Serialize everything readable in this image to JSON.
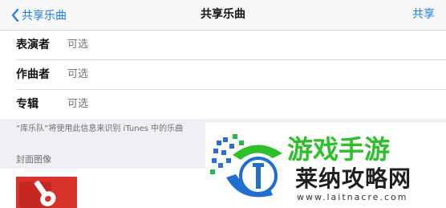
{
  "nav": {
    "back_label": "共享乐曲",
    "title": "共享乐曲",
    "share_label": "共享"
  },
  "form": {
    "fields": [
      {
        "label": "表演者",
        "placeholder": "可选"
      },
      {
        "label": "作曲者",
        "placeholder": "可选"
      },
      {
        "label": "专辑",
        "placeholder": "可选"
      }
    ]
  },
  "note": "“库乐队”将使用此信息来识别 iTunes 中的乐曲",
  "cover": {
    "label": "封面图像"
  },
  "watermark": {
    "brand": "莱纳攻略网",
    "url": "www.laitnacre.com",
    "green_text": "游戏手游"
  },
  "colors": {
    "accent": "#1a7cf5",
    "album_red": "#d9322b",
    "watermark_green": "#2fbf2a"
  },
  "icons": {
    "back": "chevron-left-icon",
    "album": "guitar-icon",
    "watermark_logo": "watermark-logo-icon"
  }
}
